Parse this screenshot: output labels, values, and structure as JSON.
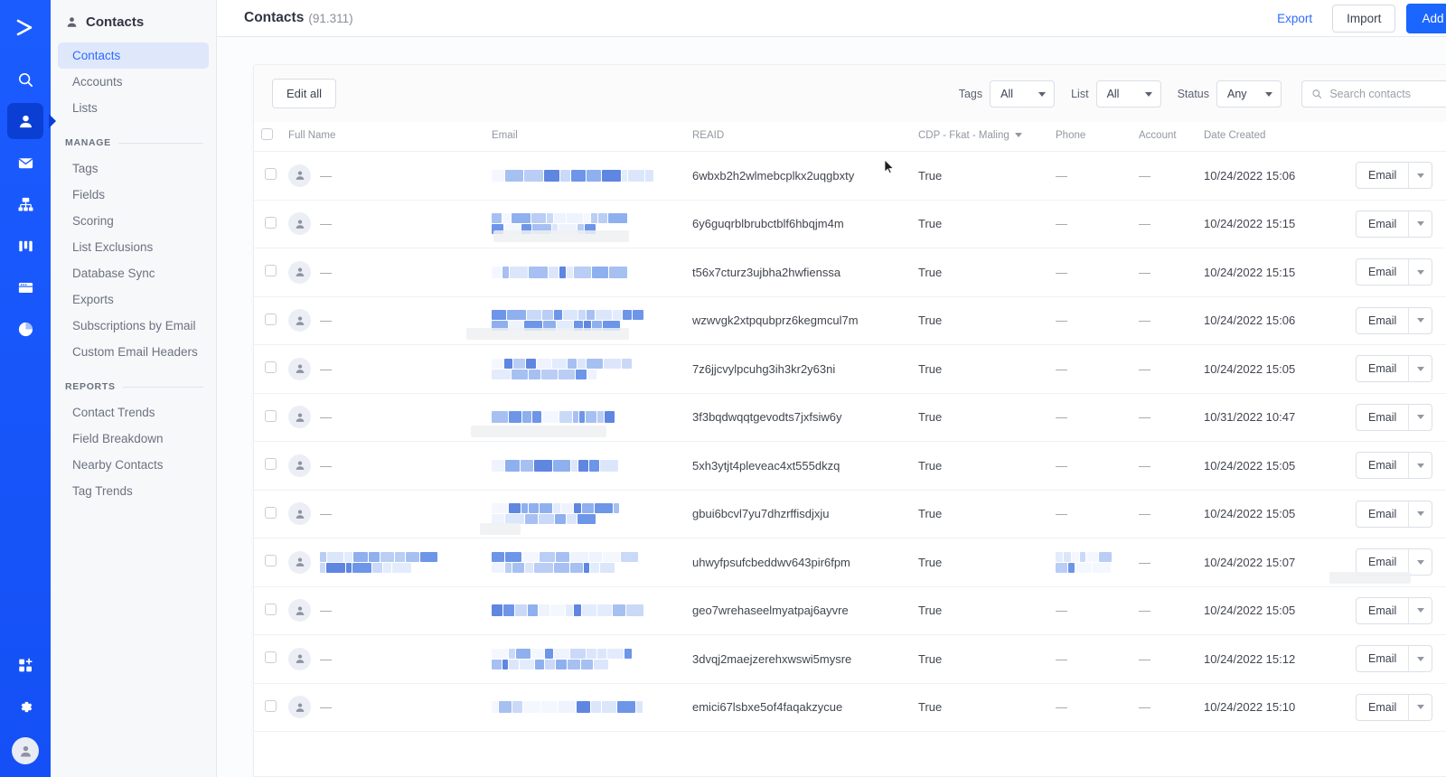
{
  "rail": {
    "logo_icon": "chevron-logo",
    "icons": [
      {
        "name": "search-icon",
        "active": false
      },
      {
        "name": "contacts-person-icon",
        "active": true
      },
      {
        "name": "campaigns-envelope-icon",
        "active": false
      },
      {
        "name": "automations-flow-icon",
        "active": false
      },
      {
        "name": "deals-kanban-icon",
        "active": false
      },
      {
        "name": "pages-website-icon",
        "active": false
      },
      {
        "name": "reports-pie-icon",
        "active": false
      }
    ],
    "bottom_icons": [
      {
        "name": "apps-add-icon"
      },
      {
        "name": "settings-gear-icon"
      }
    ],
    "account_avatar_icon": "user-avatar-icon"
  },
  "sidebar": {
    "title": "Contacts",
    "title_icon": "person-icon",
    "items": [
      {
        "label": "Contacts",
        "active": true
      },
      {
        "label": "Accounts",
        "active": false
      },
      {
        "label": "Lists",
        "active": false
      }
    ],
    "groups": [
      {
        "label": "MANAGE",
        "items": [
          {
            "label": "Tags"
          },
          {
            "label": "Fields"
          },
          {
            "label": "Scoring"
          },
          {
            "label": "List Exclusions"
          },
          {
            "label": "Database Sync"
          },
          {
            "label": "Exports"
          },
          {
            "label": "Subscriptions by Email"
          },
          {
            "label": "Custom Email Headers"
          }
        ]
      },
      {
        "label": "REPORTS",
        "items": [
          {
            "label": "Contact Trends"
          },
          {
            "label": "Field Breakdown"
          },
          {
            "label": "Nearby Contacts"
          },
          {
            "label": "Tag Trends"
          }
        ]
      }
    ]
  },
  "header": {
    "title": "Contacts",
    "count": "(91.311)",
    "export_label": "Export",
    "import_label": "Import",
    "add_contact_label": "Add a contact"
  },
  "toolbar": {
    "edit_all_label": "Edit all",
    "filters": [
      {
        "label": "Tags",
        "value": "All"
      },
      {
        "label": "List",
        "value": "All"
      },
      {
        "label": "Status",
        "value": "Any"
      }
    ],
    "search_placeholder": "Search contacts",
    "search_value": "",
    "search_icon": "search-icon"
  },
  "table": {
    "columns": [
      {
        "key": "checkbox",
        "label": ""
      },
      {
        "key": "full_name",
        "label": "Full Name"
      },
      {
        "key": "email",
        "label": "Email"
      },
      {
        "key": "reaid",
        "label": "REAID"
      },
      {
        "key": "cdp",
        "label": "CDP - Fkat - Maling",
        "sortable": true
      },
      {
        "key": "phone",
        "label": "Phone"
      },
      {
        "key": "account",
        "label": "Account"
      },
      {
        "key": "date_created",
        "label": "Date Created"
      },
      {
        "key": "actions",
        "label": ""
      },
      {
        "key": "settings",
        "label": ""
      }
    ],
    "settings_icon": "gear-icon",
    "action_label": "Email",
    "rows": [
      {
        "full_name": "—",
        "name_redacted": false,
        "email_redacted": true,
        "reaid": "6wbxb2h2wlmebcplkx2uqgbxty",
        "cdp": "True",
        "phone": "—",
        "phone_redacted": false,
        "account": "—",
        "date_created": "10/24/2022 15:06"
      },
      {
        "full_name": "—",
        "name_redacted": false,
        "email_redacted": true,
        "reaid": "6y6guqrblbrubctblf6hbqjm4m",
        "cdp": "True",
        "phone": "—",
        "phone_redacted": false,
        "account": "—",
        "date_created": "10/24/2022 15:15"
      },
      {
        "full_name": "—",
        "name_redacted": false,
        "email_redacted": true,
        "reaid": "t56x7cturz3ujbha2hwfienssa",
        "cdp": "True",
        "phone": "—",
        "phone_redacted": false,
        "account": "—",
        "date_created": "10/24/2022 15:15"
      },
      {
        "full_name": "—",
        "name_redacted": false,
        "email_redacted": true,
        "reaid": "wzwvgk2xtpqubprz6kegmcul7m",
        "cdp": "True",
        "phone": "—",
        "phone_redacted": false,
        "account": "—",
        "date_created": "10/24/2022 15:06"
      },
      {
        "full_name": "—",
        "name_redacted": false,
        "email_redacted": true,
        "reaid": "7z6jjcvylpcuhg3ih3kr2y63ni",
        "cdp": "True",
        "phone": "—",
        "phone_redacted": false,
        "account": "—",
        "date_created": "10/24/2022 15:05"
      },
      {
        "full_name": "—",
        "name_redacted": false,
        "email_redacted": true,
        "reaid": "3f3bqdwqqtgevodts7jxfsiw6y",
        "cdp": "True",
        "phone": "—",
        "phone_redacted": false,
        "account": "—",
        "date_created": "10/31/2022 10:47"
      },
      {
        "full_name": "—",
        "name_redacted": false,
        "email_redacted": true,
        "reaid": "5xh3ytjt4pleveac4xt555dkzq",
        "cdp": "True",
        "phone": "—",
        "phone_redacted": false,
        "account": "—",
        "date_created": "10/24/2022 15:05"
      },
      {
        "full_name": "—",
        "name_redacted": false,
        "email_redacted": true,
        "reaid": "gbui6bcvl7yu7dhzrffisdjxju",
        "cdp": "True",
        "phone": "—",
        "phone_redacted": false,
        "account": "—",
        "date_created": "10/24/2022 15:05"
      },
      {
        "full_name": "",
        "name_redacted": true,
        "email_redacted": true,
        "reaid": "uhwyfpsufcbeddwv643pir6fpm",
        "cdp": "True",
        "phone": "",
        "phone_redacted": true,
        "account": "—",
        "date_created": "10/24/2022 15:07"
      },
      {
        "full_name": "—",
        "name_redacted": false,
        "email_redacted": true,
        "reaid": "geo7wrehaseelmyatpaj6ayvre",
        "cdp": "True",
        "phone": "—",
        "phone_redacted": false,
        "account": "—",
        "date_created": "10/24/2022 15:05"
      },
      {
        "full_name": "—",
        "name_redacted": false,
        "email_redacted": true,
        "reaid": "3dvqj2maejzerehxwswi5mysre",
        "cdp": "True",
        "phone": "—",
        "phone_redacted": false,
        "account": "—",
        "date_created": "10/24/2022 15:12"
      },
      {
        "full_name": "—",
        "name_redacted": false,
        "email_redacted": true,
        "reaid": "emici67lsbxe5of4faqakzycue",
        "cdp": "True",
        "phone": "—",
        "phone_redacted": false,
        "account": "—",
        "date_created": "10/24/2022 15:10"
      }
    ]
  },
  "colors": {
    "brand_blue": "#1a66ff",
    "rail_blue": "#1b5cff",
    "active_nav_bg": "#dfe7fb",
    "active_nav_text": "#2f6bff",
    "link_blue": "#2f6bff",
    "text_primary": "#2f3542",
    "text_muted": "#9297a2",
    "border": "#e6e8ec",
    "panel_bg": "#ffffff"
  }
}
